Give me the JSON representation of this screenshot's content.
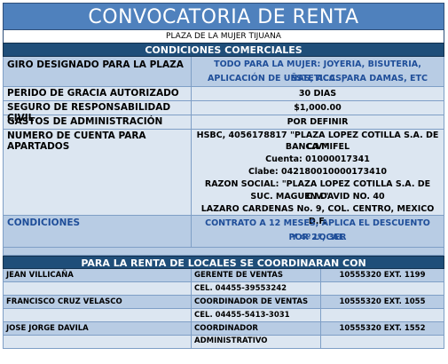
{
  "title": "CONVOCATORIA DE RENTA",
  "subtitle": "PLAZA DE LA MUJER TIJUANA",
  "section_conditions": "CONDICIONES COMERCIALES",
  "rows": [
    {
      "label": "GIRO DESIGNADO PARA LA PLAZA",
      "lines": [
        "TODO PARA LA MUJER: JOYERIA, BISUTERIA, ESTETICAS,",
        "APLICACIÓN DE UÑAS, ACC. PARA DAMAS, ETC"
      ]
    },
    {
      "label": "PERIDO DE GRACIA AUTORIZADO",
      "lines": [
        "30 DIAS"
      ]
    },
    {
      "label": "SEGURO DE RESPONSABILIDAD CIVIL",
      "lines": [
        "$1,000.00"
      ]
    },
    {
      "label": "GASTOS DE ADMINISTRACIÓN",
      "lines": [
        "POR DEFINIR"
      ]
    },
    {
      "label": "NUMERO DE CUENTA PARA APARTADOS",
      "lines": [
        "HSBC, 4056178817 \"PLAZA LOPEZ COTILLA S.A. DE C.V.\"",
        "BANCA MIFEL",
        "Cuenta: 01000017341",
        "Clabe: 042180010000173410",
        "RAZON SOCIAL: \"PLAZA LOPEZ COTILLA S.A. DE C.V.\"",
        "SUC.  MAGUEN DAVID NO. 40",
        "LAZARO CARDENAS No. 9, COL. CENTRO, MEXICO D.F."
      ]
    },
    {
      "label": "CONDICIONES",
      "lines": [
        "CONTRATO A 12 MESES, APLICA EL DESCUENTO POR 2º, 3ER",
        "Y 4º LOCAL"
      ]
    }
  ],
  "section_contacts": "PARA LA RENTA DE LOCALES SE COORDINARAN CON",
  "contacts": [
    {
      "name": "JEAN VILLICAÑA",
      "role": "GERENTE DE VENTAS",
      "phone": "10555320 EXT. 1199"
    },
    {
      "name": "",
      "role": "CEL. 04455-39553242",
      "phone": ""
    },
    {
      "name": "FRANCISCO CRUZ VELASCO",
      "role": "COORDINADOR DE VENTAS",
      "phone": "10555320 EXT. 1055"
    },
    {
      "name": "",
      "role": "CEL. 04455-5413-3031",
      "phone": ""
    },
    {
      "name": "JOSE JORGE DAVILA",
      "role": "COORDINADOR ADMINISTRATIVO",
      "phone": "10555320 EXT. 1552"
    },
    {
      "name": "",
      "role": "",
      "phone": ""
    }
  ]
}
